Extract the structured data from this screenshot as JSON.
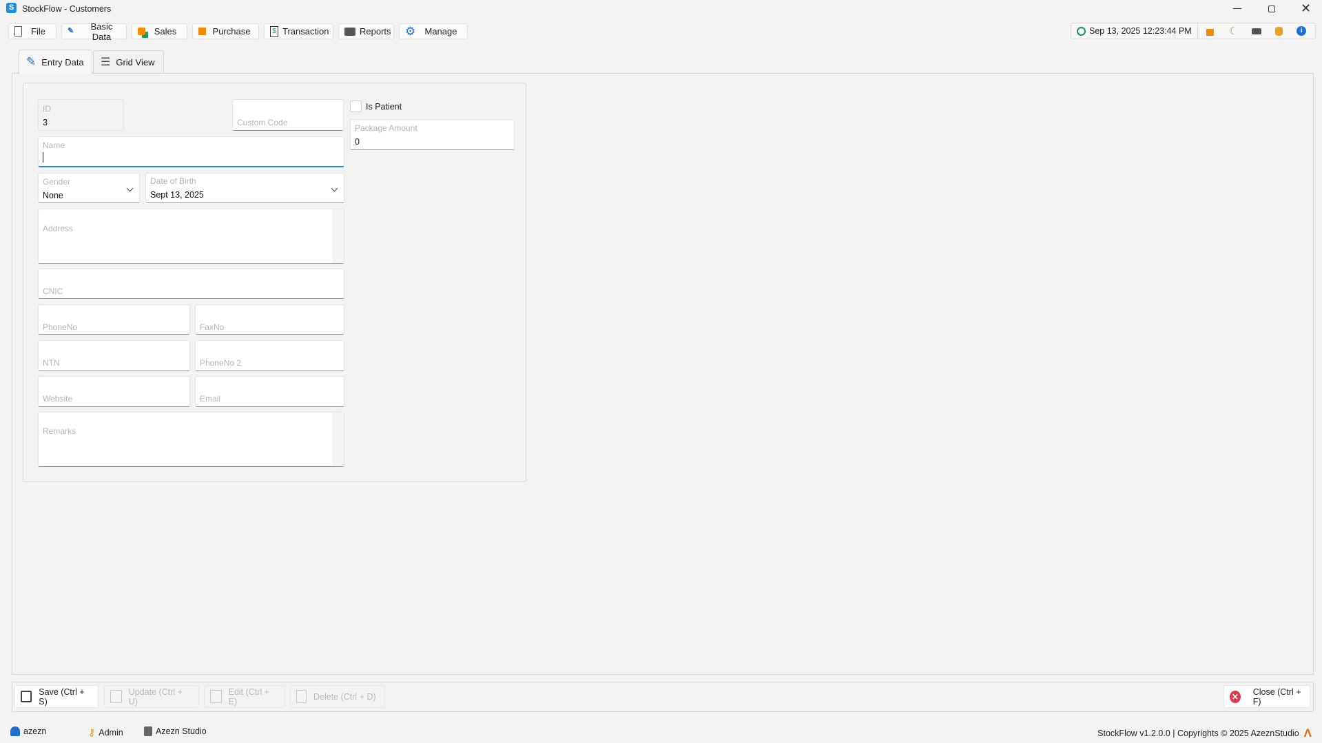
{
  "window": {
    "title": "StockFlow - Customers",
    "app_icon_letter": "S"
  },
  "menu": [
    {
      "label": "File",
      "icon": "file-icon"
    },
    {
      "label": "Basic Data",
      "icon": "basic-data-icon"
    },
    {
      "label": "Sales",
      "icon": "sales-icon"
    },
    {
      "label": "Purchase",
      "icon": "purchase-icon"
    },
    {
      "label": "Transaction",
      "icon": "transaction-icon"
    },
    {
      "label": "Reports",
      "icon": "printer-icon"
    },
    {
      "label": "Manage",
      "icon": "gear-icon"
    }
  ],
  "header": {
    "datetime": "Sep 13, 2025 12:23:44 PM",
    "icons": [
      "lock-icon",
      "moon-icon",
      "keyboard-icon",
      "database-icon",
      "info-icon"
    ]
  },
  "tabs": [
    {
      "label": "Entry Data"
    },
    {
      "label": "Grid View"
    }
  ],
  "form": {
    "id": {
      "label": "ID",
      "value": "3"
    },
    "custom_code": {
      "placeholder": "Custom Code"
    },
    "is_patient": {
      "label": "Is Patient",
      "checked": false
    },
    "package_amount": {
      "label": "Package Amount",
      "value": "0"
    },
    "name": {
      "label": "Name",
      "value": ""
    },
    "gender": {
      "label": "Gender",
      "value": "None"
    },
    "dob": {
      "label": "Date of Birth",
      "value": "Sept 13, 2025"
    },
    "address": {
      "placeholder": "Address"
    },
    "cnic": {
      "placeholder": "CNIC"
    },
    "phone": {
      "placeholder": "PhoneNo"
    },
    "fax": {
      "placeholder": "FaxNo"
    },
    "ntn": {
      "placeholder": "NTN"
    },
    "phone2": {
      "placeholder": "PhoneNo 2"
    },
    "website": {
      "placeholder": "Website"
    },
    "email": {
      "placeholder": "Email"
    },
    "remarks": {
      "placeholder": "Remarks"
    }
  },
  "toolbar": {
    "save": "Save (Ctrl + S)",
    "update": "Update (Ctrl + U)",
    "edit": "Edit (Ctrl + E)",
    "delete": "Delete (Ctrl + D)",
    "close": "Close (Ctrl + F)"
  },
  "status": {
    "user": "azezn",
    "role": "Admin",
    "company": "Azezn Studio",
    "version": "StockFlow v1.2.0.0 | Copyrights © 2025 AzeznStudio"
  },
  "colors": {
    "accent": "#1e90c8",
    "orange": "#f08a00",
    "danger": "#e0394a"
  }
}
